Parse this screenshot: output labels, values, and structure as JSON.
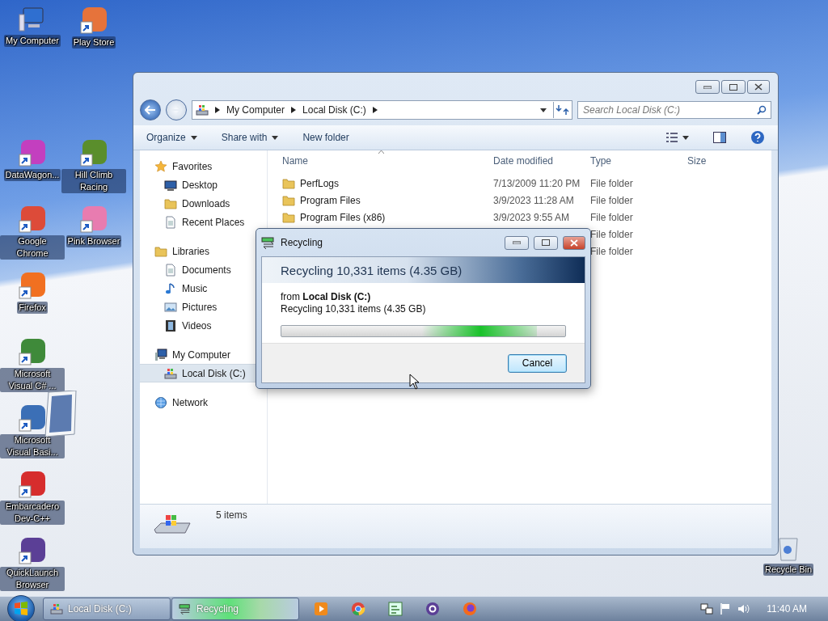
{
  "desktop": {
    "icons": [
      {
        "label": "My Computer",
        "kind": "computer"
      },
      {
        "label": "Play Store",
        "kind": "app"
      },
      {
        "label": "DataWagon...",
        "kind": "app"
      },
      {
        "label": "Hill Climb Racing",
        "kind": "app"
      },
      {
        "label": "Google Chrome",
        "kind": "app"
      },
      {
        "label": "Pink Browser",
        "kind": "app"
      },
      {
        "label": "Firefox",
        "kind": "app"
      },
      {
        "label": "Microsoft Visual C# ...",
        "kind": "app"
      },
      {
        "label": "Microsoft Visual Basi...",
        "kind": "app"
      },
      {
        "label": "Embarcadero Dev-C++",
        "kind": "app"
      },
      {
        "label": "QuickLaunch Browser",
        "kind": "app"
      },
      {
        "label": "Recycle Bin",
        "kind": "bin"
      }
    ]
  },
  "explorer": {
    "breadcrumb": [
      "My Computer",
      "Local Disk (C:)"
    ],
    "search": {
      "placeholder": "Search Local Disk (C:)"
    },
    "toolbar": [
      {
        "label": "Organize",
        "dropdown": true
      },
      {
        "label": "Share with",
        "dropdown": true
      },
      {
        "label": "New folder",
        "dropdown": false
      }
    ],
    "nav": [
      {
        "label": "Favorites",
        "kind": "star",
        "selected": false,
        "children": [
          {
            "label": "Desktop",
            "kind": "desktop",
            "selected": false
          },
          {
            "label": "Downloads",
            "kind": "folder",
            "selected": false
          },
          {
            "label": "Recent Places",
            "kind": "doc",
            "selected": false
          }
        ]
      },
      {
        "label": "Libraries",
        "kind": "folder",
        "selected": false,
        "children": [
          {
            "label": "Documents",
            "kind": "doc",
            "selected": false
          },
          {
            "label": "Music",
            "kind": "music",
            "selected": false
          },
          {
            "label": "Pictures",
            "kind": "picture",
            "selected": false
          },
          {
            "label": "Videos",
            "kind": "film",
            "selected": false
          }
        ]
      },
      {
        "label": "My Computer",
        "kind": "computer",
        "selected": false,
        "children": [
          {
            "label": "Local Disk (C:)",
            "kind": "disk",
            "selected": true
          }
        ]
      },
      {
        "label": "Network",
        "kind": "network",
        "selected": false
      }
    ],
    "columns": [
      "Name",
      "Date modified",
      "Type",
      "Size"
    ],
    "rows": [
      {
        "name": "PerfLogs",
        "date": "7/13/2009 11:20 PM",
        "type": "File folder"
      },
      {
        "name": "Program Files",
        "date": "3/9/2023 11:28 AM",
        "type": "File folder"
      },
      {
        "name": "Program Files (x86)",
        "date": "3/9/2023 9:55 AM",
        "type": "File folder"
      },
      {
        "type": "File folder"
      },
      {
        "type": "File folder"
      }
    ],
    "status": "5 items"
  },
  "dialog": {
    "title": "Recycling",
    "heading": "Recycling 10,331 items (4.35 GB)",
    "from": "from **Local Disk (C:)**",
    "detail": "Recycling 10,331 items (4.35 GB)",
    "button": "Cancel",
    "level": 0.9
  },
  "taskbar": {
    "tasks": [
      {
        "label": "Local Disk (C:)",
        "selected": false
      },
      {
        "label": "Recycling",
        "selected": true
      }
    ],
    "clock": "11:40 AM"
  }
}
